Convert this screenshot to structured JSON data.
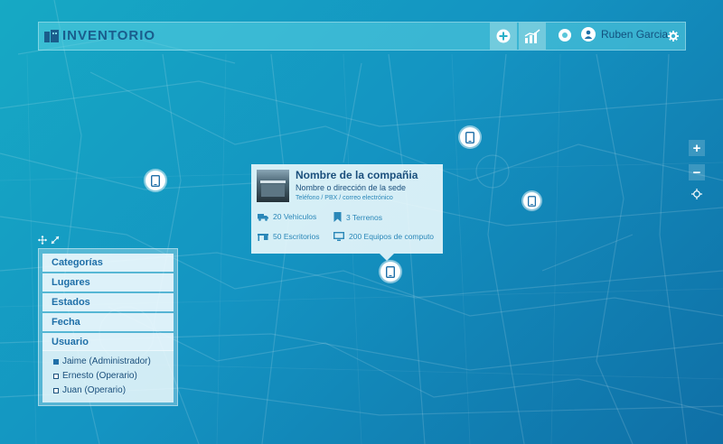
{
  "app": {
    "logo_text": "INVENTORIO"
  },
  "header": {
    "add_icon": "plus-circle-icon",
    "chart_icon": "chart-icon",
    "notification_icon": "dot-icon",
    "user_icon": "user-icon",
    "user_name": "Ruben Garcia",
    "settings_icon": "gear-icon"
  },
  "popup": {
    "company_name": "Nombre de la compañia",
    "address": "Nombre o dirección de la sede",
    "contact": "Teléfono / PBX / correo electrónico",
    "stats": [
      {
        "icon": "truck-icon",
        "label": "20 Vehiculos"
      },
      {
        "icon": "bookmark-icon",
        "label": "3 Terrenos"
      },
      {
        "icon": "desk-icon",
        "label": "50 Escritorios"
      },
      {
        "icon": "monitor-icon",
        "label": "200 Equipos de computo"
      }
    ]
  },
  "filters": {
    "categories": [
      "Categorías",
      "Lugares",
      "Estados",
      "Fecha",
      "Usuario"
    ],
    "users": [
      {
        "label": "Jaime (Administrador)",
        "checked": true
      },
      {
        "label": "Ernesto (Operario)",
        "checked": false
      },
      {
        "label": "Juan (Operario)",
        "checked": false
      }
    ]
  },
  "map_controls": {
    "zoom_in": "+",
    "zoom_out": "−",
    "locate_icon": "crosshair-icon"
  },
  "colors": {
    "accent": "#1f6fa8",
    "map_background": "#1494c2",
    "header_bg": "#5ad2e1"
  }
}
